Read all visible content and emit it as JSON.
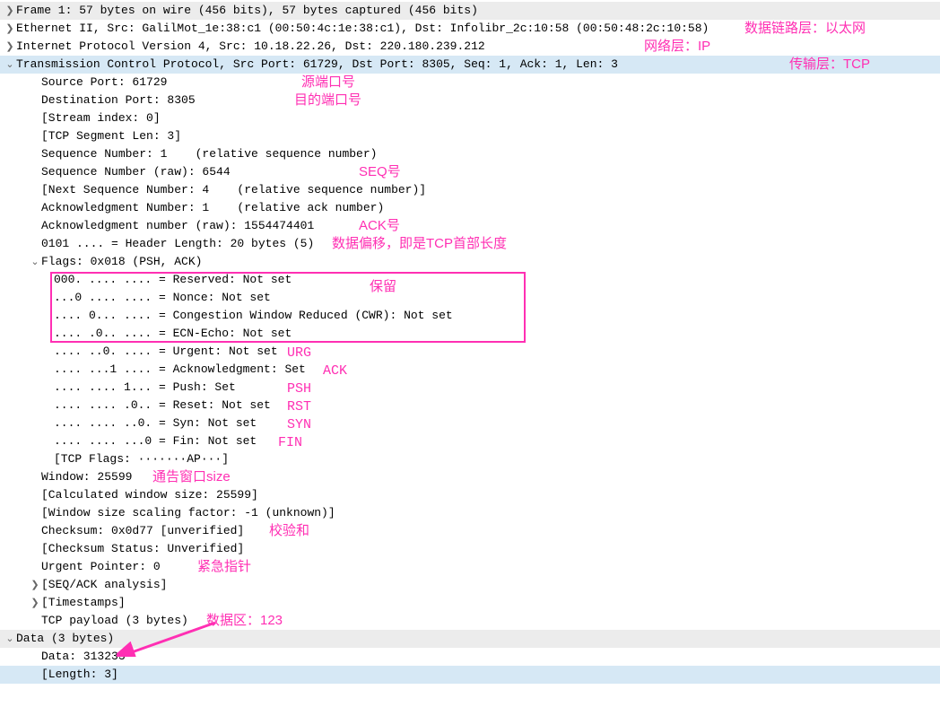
{
  "rows": {
    "frame": "Frame 1: 57 bytes on wire (456 bits), 57 bytes captured (456 bits)",
    "ethernet": "Ethernet II, Src: GalilMot_1e:38:c1 (00:50:4c:1e:38:c1), Dst: Infolibr_2c:10:58 (00:50:48:2c:10:58)",
    "ip": "Internet Protocol Version 4, Src: 10.18.22.26, Dst: 220.180.239.212",
    "tcp": "Transmission Control Protocol, Src Port: 61729, Dst Port: 8305, Seq: 1, Ack: 1, Len: 3",
    "srcport": "Source Port: 61729",
    "dstport": "Destination Port: 8305",
    "stream": "[Stream index: 0]",
    "seglen": "[TCP Segment Len: 3]",
    "seqnum": "Sequence Number: 1    (relative sequence number)",
    "seqraw": "Sequence Number (raw): 6544",
    "nextseq": "[Next Sequence Number: 4    (relative sequence number)]",
    "acknum": "Acknowledgment Number: 1    (relative ack number)",
    "ackraw": "Acknowledgment number (raw): 1554474401",
    "hdrlen": "0101 .... = Header Length: 20 bytes (5)",
    "flags": "Flags: 0x018 (PSH, ACK)",
    "reserved": "000. .... .... = Reserved: Not set",
    "nonce": "...0 .... .... = Nonce: Not set",
    "cwr": ".... 0... .... = Congestion Window Reduced (CWR): Not set",
    "ecn": ".... .0.. .... = ECN-Echo: Not set",
    "urgent": ".... ..0. .... = Urgent: Not set",
    "ack": ".... ...1 .... = Acknowledgment: Set",
    "push": ".... .... 1... = Push: Set",
    "reset": ".... .... .0.. = Reset: Not set",
    "syn": ".... .... ..0. = Syn: Not set",
    "fin": ".... .... ...0 = Fin: Not set",
    "tcpflags": "[TCP Flags: ·······AP···]",
    "window": "Window: 25599",
    "calcwin": "[Calculated window size: 25599]",
    "winscale": "[Window size scaling factor: -1 (unknown)]",
    "checksum": "Checksum: 0x0d77 [unverified]",
    "chkstatus": "[Checksum Status: Unverified]",
    "urgptr": "Urgent Pointer: 0",
    "seqack": "[SEQ/ACK analysis]",
    "timestamps": "[Timestamps]",
    "payload": "TCP payload (3 bytes)",
    "datahdr": "Data (3 bytes)",
    "databytes": "Data: 313233",
    "datalen": "[Length: 3]"
  },
  "annotations": {
    "datalink": "数据链路层：以太网",
    "netlayer": "网络层：IP",
    "transport": "传输层：TCP",
    "srcport_zh": "源端口号",
    "dstport_zh": "目的端口号",
    "seq_zh": "SEQ号",
    "ack_zh": "ACK号",
    "offset_zh": "数据偏移，即是TCP首部长度",
    "reserved_zh": "保留",
    "urg": "URG",
    "ack_flag": "ACK",
    "psh": "PSH",
    "rst": "RST",
    "syn": "SYN",
    "fin": "FIN",
    "window_zh": "通告窗口size",
    "checksum_zh": "校验和",
    "urgptr_zh": "紧急指针",
    "data_zh": "数据区：123"
  },
  "icons": {
    "collapsed": "❯",
    "expanded": "⌄"
  }
}
